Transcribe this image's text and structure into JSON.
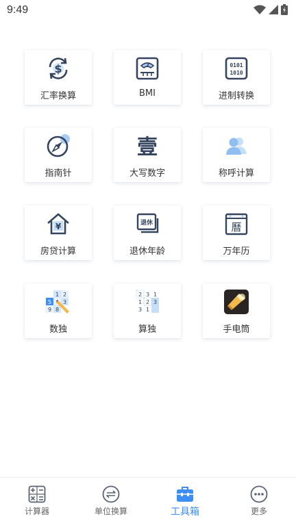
{
  "status": {
    "time": "9:49"
  },
  "tools": [
    {
      "label": "汇率换算",
      "icon": "exchange-rate-icon"
    },
    {
      "label": "BMI",
      "icon": "scale-icon"
    },
    {
      "label": "进制转换",
      "icon": "binary-icon"
    },
    {
      "label": "指南针",
      "icon": "compass-icon"
    },
    {
      "label": "大写数字",
      "icon": "chinese-numeral-icon",
      "glyph": "壹"
    },
    {
      "label": "称呼计算",
      "icon": "people-icon"
    },
    {
      "label": "房贷计算",
      "icon": "house-yuan-icon",
      "glyph": "¥"
    },
    {
      "label": "退休年龄",
      "icon": "retire-icon",
      "glyph": "退休"
    },
    {
      "label": "万年历",
      "icon": "calendar-icon",
      "glyph": "曆"
    },
    {
      "label": "数独",
      "icon": "sudoku-icon"
    },
    {
      "label": "算独",
      "icon": "math-sudoku-icon"
    },
    {
      "label": "手电筒",
      "icon": "flashlight-icon"
    }
  ],
  "tabbar": {
    "items": [
      {
        "label": "计算器",
        "icon": "calculator-icon"
      },
      {
        "label": "单位换算",
        "icon": "unit-convert-icon"
      },
      {
        "label": "工具箱",
        "icon": "toolbox-icon",
        "active": true
      },
      {
        "label": "更多",
        "icon": "more-icon"
      }
    ]
  },
  "colors": {
    "accent": "#3d8ef5",
    "icon_dark": "#34445e",
    "icon_light": "#a8cdf5"
  }
}
